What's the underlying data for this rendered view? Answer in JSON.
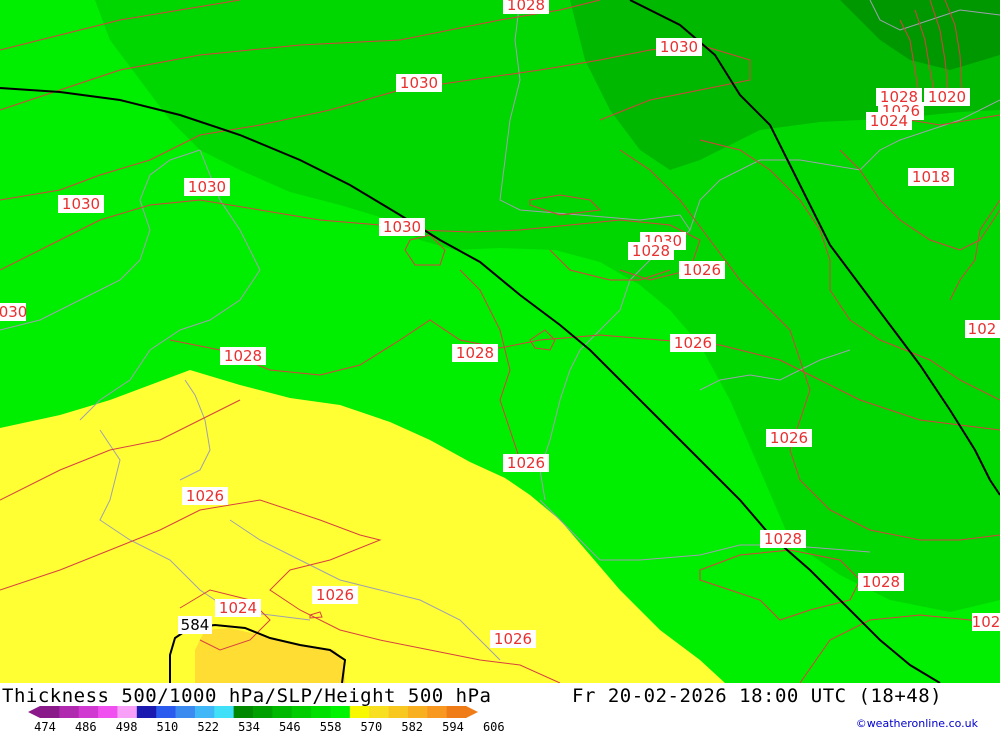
{
  "map": {
    "colors": {
      "band_558": "#00ee00",
      "band_552": "#00d600",
      "band_546": "#00b800",
      "band_540": "#009800",
      "band_570": "#ffff33",
      "band_576": "#ffdd33",
      "isobar": "#d84040",
      "coast": "#a0a0b0",
      "height_line": "#000000",
      "label_text": "#e83030"
    },
    "isobar_labels": {
      "l1": "1028",
      "l2": "1030",
      "l3": "1030",
      "l4": "1030",
      "l5": "1030",
      "l6": "1028",
      "l7": "1026",
      "l8": "1024",
      "l9": "1020",
      "l10": "1018",
      "l11": "1030",
      "l12": "030",
      "l13": "1030",
      "l14": "1028",
      "l15": "1026",
      "l16": "1028",
      "l17": "1028",
      "l18": "1026",
      "l19": "102",
      "l20": "1026",
      "l21": "1026",
      "l22": "1026",
      "l23": "1028",
      "l24": "1028",
      "l25": "1024",
      "l26": "1026",
      "l27": "1026",
      "l28": "102"
    },
    "height_labels": {
      "h1": "584"
    }
  },
  "footer": {
    "title": "Thickness 500/1000 hPa/SLP/Height 500 hPa",
    "datetime": "Fr 20-02-2026 18:00 UTC (18+48)",
    "credit": "©weatheronline.co.uk",
    "scale_ticks": [
      "474",
      "486",
      "498",
      "510",
      "522",
      "534",
      "546",
      "558",
      "570",
      "582",
      "594",
      "606"
    ],
    "scale_colors": [
      "#8a1a8a",
      "#b02ab0",
      "#d03ad0",
      "#f050f0",
      "#f8a0f8",
      "#1a1ab0",
      "#2a5aee",
      "#3a8af0",
      "#40b8f8",
      "#40e0f8",
      "#008800",
      "#00a000",
      "#00b800",
      "#00cc00",
      "#00e000",
      "#00f400",
      "#f8f800",
      "#f8e020",
      "#f8c820",
      "#f8b020",
      "#f89820",
      "#f07c18"
    ]
  }
}
